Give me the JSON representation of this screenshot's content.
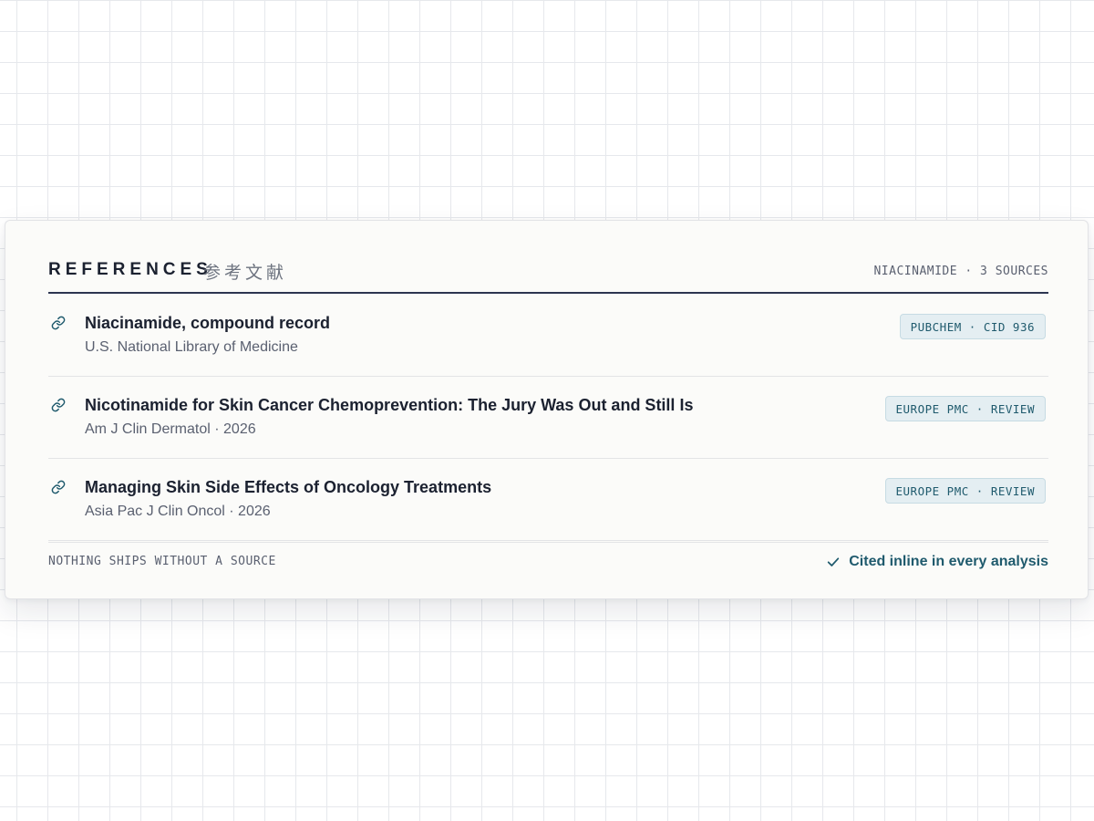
{
  "panel": {
    "title": "REFERENCES",
    "title_cjk": "参考文献",
    "meta": "NIACINAMIDE · 3 SOURCES"
  },
  "references": [
    {
      "title": "Niacinamide, compound record",
      "subtitle": "U.S. National Library of Medicine",
      "badge": "PUBCHEM · CID 936",
      "icon": "link-icon"
    },
    {
      "title": "Nicotinamide for Skin Cancer Chemoprevention: The Jury Was Out and Still Is",
      "subtitle": "Am J Clin Dermatol · 2026",
      "badge": "EUROPE PMC · REVIEW",
      "icon": "link-icon"
    },
    {
      "title": "Managing Skin Side Effects of Oncology Treatments",
      "subtitle": "Asia Pac J Clin Oncol · 2026",
      "badge": "EUROPE PMC · REVIEW",
      "icon": "link-icon"
    }
  ],
  "footer": {
    "left": "NOTHING SHIPS WITHOUT A SOURCE",
    "right": "Cited inline in every analysis",
    "right_icon": "check-icon"
  },
  "colors": {
    "accent": "#1f5a6d",
    "badge_bg": "#e4eef2",
    "title": "#1b2130",
    "muted": "#5a6070",
    "rule": "#2c3550"
  }
}
